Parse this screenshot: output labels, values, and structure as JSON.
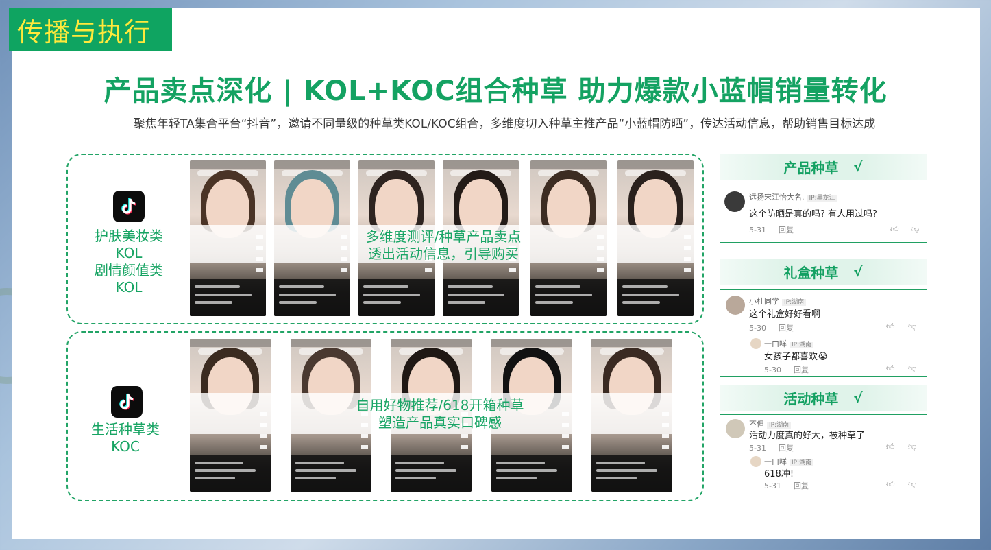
{
  "section_tag": "传播与执行",
  "headline": "产品卖点深化 | KOL+KOC组合种草  助力爆款小蓝帽销量转化",
  "subline": "聚焦年轻TA集合平台“抖音”，邀请不同量级的种草类KOL/KOC组合，多维度切入种草主推产品“小蓝帽防晒”，传达活动信息，帮助销售目标达成",
  "kol_group": {
    "label_lines": [
      "护肤美妆类",
      "KOL",
      "剧情颜值类",
      "KOL"
    ],
    "overlay_lines": [
      "多维度测评/种草产品卖点",
      "透出活动信息，引导购买"
    ]
  },
  "koc_group": {
    "label_lines": [
      "生活种草类",
      "KOC"
    ],
    "overlay_lines": [
      "自用好物推荐/618开箱种草",
      "塑造产品真实口碑感"
    ]
  },
  "side": [
    {
      "title": "产品种草",
      "check": "√",
      "comments": [
        {
          "name": "远扬宋江怡大名.",
          "ip": "IP:黑龙江",
          "text": "这个防晒是真的吗? 有人用过吗?",
          "date": "5-31",
          "reply": "回复"
        }
      ]
    },
    {
      "title": "礼盒种草",
      "check": "√",
      "comments": [
        {
          "name": "小杜同学",
          "ip": "IP:湖南",
          "text": "这个礼盒好好看啊",
          "date": "5-30",
          "reply": "回复"
        },
        {
          "name": "一口咩",
          "ip": "IP:湖南",
          "text": "女孩子都喜欢😭",
          "date": "5-30",
          "reply": "回复"
        }
      ]
    },
    {
      "title": "活动种草",
      "check": "√",
      "comments": [
        {
          "name": "不但",
          "ip": "IP:湖南",
          "text": "活动力度真的好大，被种草了",
          "date": "5-31",
          "reply": "回复"
        },
        {
          "name": "一口咩",
          "ip": "IP:湖南",
          "text": "618冲!",
          "date": "5-31",
          "reply": "回复"
        }
      ]
    }
  ],
  "colors": {
    "brand_green": "#0fa461",
    "tag_text": "#ffe93b",
    "accent": "#14a262"
  },
  "icons": [
    "tiktok-logo-icon",
    "thumb-up-icon",
    "thumb-down-icon"
  ]
}
